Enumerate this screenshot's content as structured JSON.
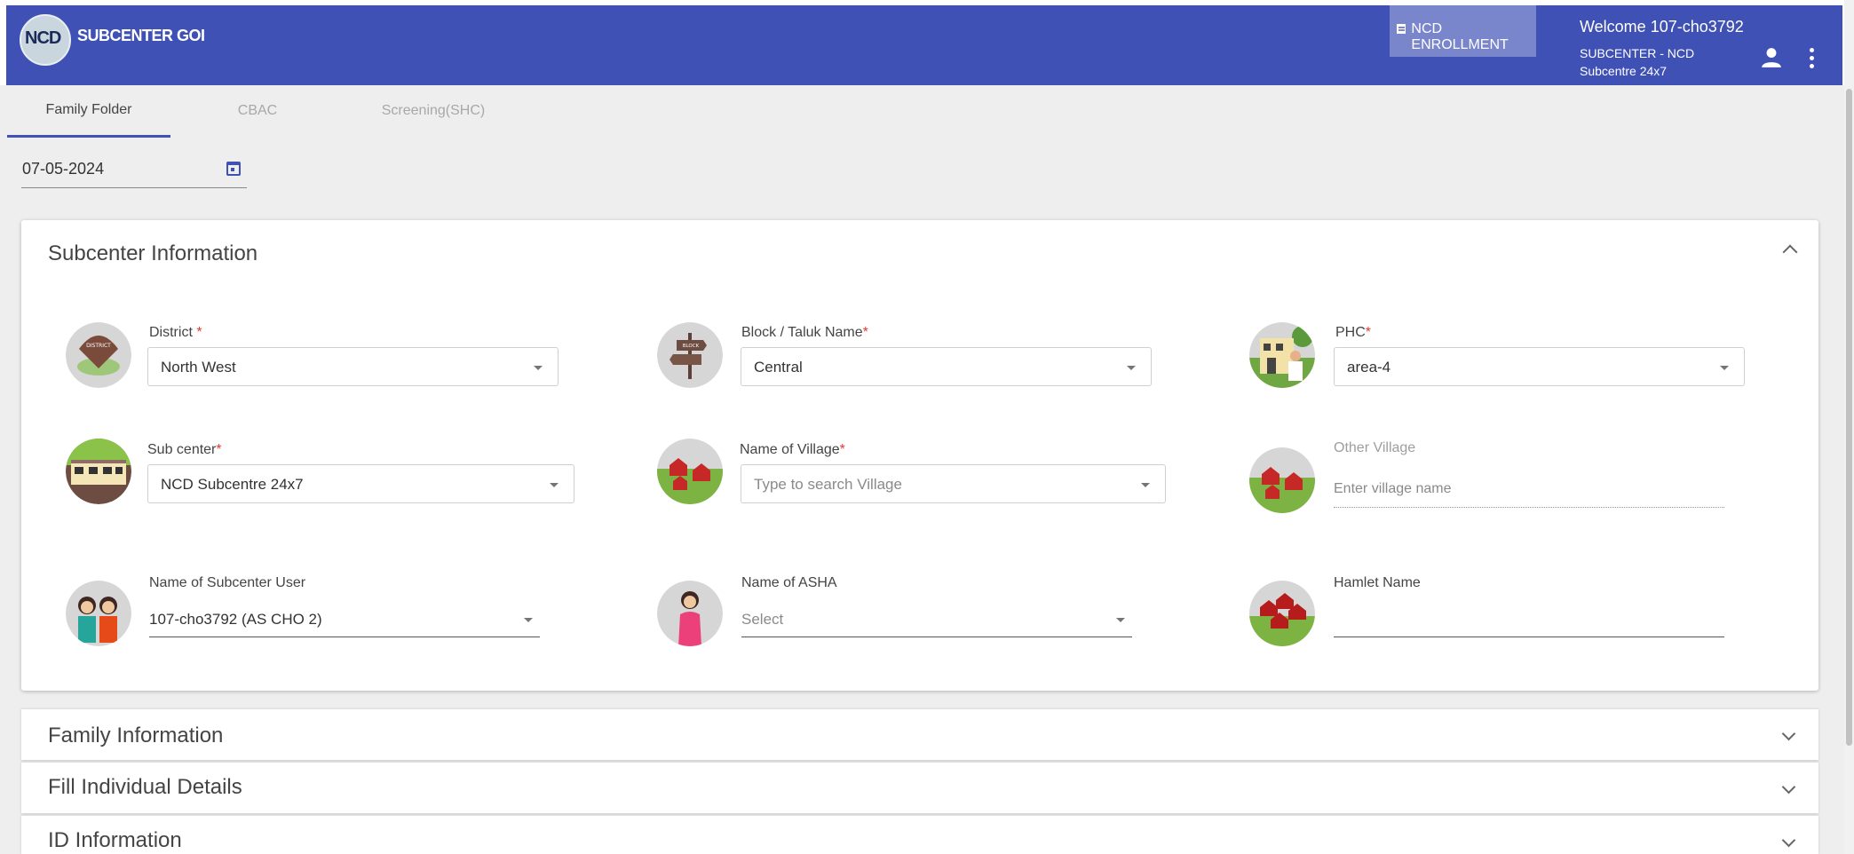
{
  "app": {
    "logo_text": "NCD",
    "title": "SUBCENTER GOI",
    "enroll_label": "NCD ENROLLMENT",
    "welcome": "Welcome 107-cho3792",
    "user_line1": "SUBCENTER - NCD",
    "user_line2": "Subcentre 24x7"
  },
  "tabs": [
    {
      "label": "Family Folder",
      "active": true
    },
    {
      "label": "CBAC",
      "active": false
    },
    {
      "label": "Screening(SHC)",
      "active": false
    }
  ],
  "date": {
    "value": "07-05-2024"
  },
  "subcenter": {
    "title": "Subcenter Information",
    "district": {
      "label": "District",
      "req": "*",
      "value": "North West"
    },
    "block": {
      "label": "Block / Taluk Name",
      "req": "*",
      "value": "Central"
    },
    "phc": {
      "label": "PHC",
      "req": "*",
      "value": "area-4"
    },
    "subcenter": {
      "label": "Sub center",
      "req": "*",
      "value": "NCD Subcentre 24x7"
    },
    "village": {
      "label": "Name of Village",
      "req": "*",
      "placeholder": "Type to search Village"
    },
    "other_village": {
      "label": "Other Village",
      "placeholder": "Enter village name"
    },
    "user": {
      "label": "Name of Subcenter User",
      "value": "107-cho3792 (AS CHO 2)"
    },
    "asha": {
      "label": "Name of ASHA",
      "placeholder": "Select"
    },
    "hamlet": {
      "label": "Hamlet Name",
      "value": ""
    },
    "avatar_badges": {
      "district": "DISTRICT",
      "block": "BLOCK"
    }
  },
  "sections": [
    {
      "title": "Family Information"
    },
    {
      "title": "Fill Individual Details"
    },
    {
      "title": "ID Information"
    }
  ],
  "colors": {
    "primary": "#3f51b5",
    "enroll_bg": "#7986cb",
    "required": "#e53935"
  }
}
